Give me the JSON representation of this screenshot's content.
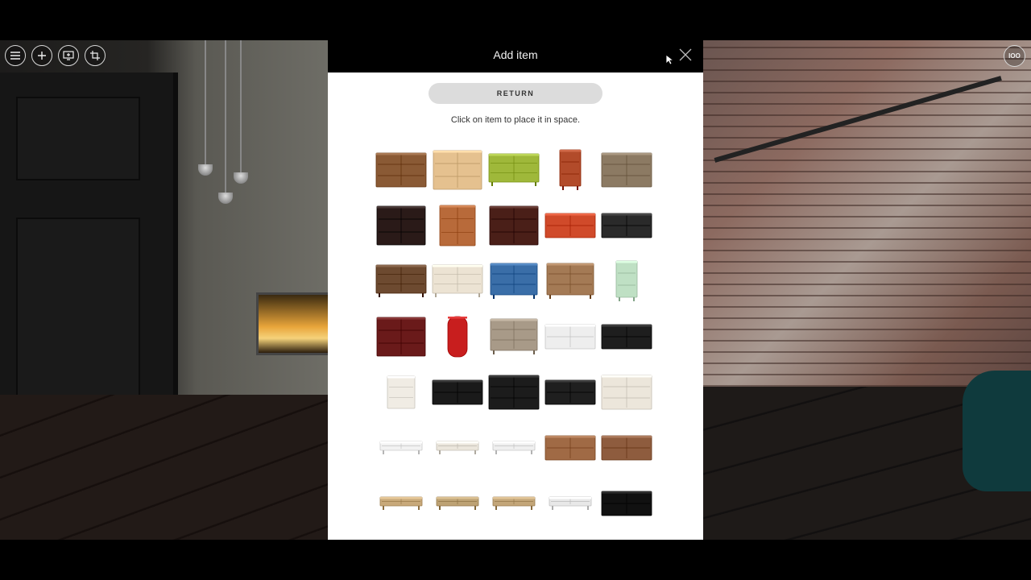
{
  "modal": {
    "title": "Add item",
    "return_label": "RETURN",
    "instruction": "Click on item to place it in space."
  },
  "toolbar": {
    "icons": [
      "menu-icon",
      "plus-icon",
      "screen-add-icon",
      "crop-icon"
    ],
    "right_icon_label": "IOO"
  },
  "catalog": [
    {
      "name": "dresser-wood-carved",
      "color": "#8a5a35",
      "shape": "wide"
    },
    {
      "name": "cabinet-light-wood",
      "color": "#e5c18f",
      "shape": "box"
    },
    {
      "name": "sideboard-lime-green",
      "color": "#9fb83a",
      "shape": "wide-legs"
    },
    {
      "name": "tall-chest-red-drawers",
      "color": "#b24b2a",
      "shape": "tall"
    },
    {
      "name": "sideboard-rustic",
      "color": "#8c7a63",
      "shape": "wide"
    },
    {
      "name": "cabinet-painted-black",
      "color": "#2a1a18",
      "shape": "box"
    },
    {
      "name": "chest-wood-drawers",
      "color": "#b86a3a",
      "shape": "tall-box"
    },
    {
      "name": "cabinet-dark-glass",
      "color": "#4a1f18",
      "shape": "box"
    },
    {
      "name": "dresser-orange-red",
      "color": "#d04a2a",
      "shape": "wide-low"
    },
    {
      "name": "console-black-metal",
      "color": "#2a2a2a",
      "shape": "wide-low"
    },
    {
      "name": "sideboard-walnut-legs",
      "color": "#6d4a30",
      "shape": "wide-legs"
    },
    {
      "name": "console-white-faceted",
      "color": "#ece3d3",
      "shape": "wide-legs"
    },
    {
      "name": "dresser-blue",
      "color": "#3a6ea8",
      "shape": "box-legs"
    },
    {
      "name": "dresser-natural-wood",
      "color": "#a47a55",
      "shape": "box-legs"
    },
    {
      "name": "chest-mint-tall",
      "color": "#bfe0c4",
      "shape": "tall"
    },
    {
      "name": "chest-mahogany",
      "color": "#6a1a1a",
      "shape": "box"
    },
    {
      "name": "round-cabinet-red",
      "color": "#c81e1e",
      "shape": "cylinder"
    },
    {
      "name": "chest-taupe",
      "color": "#a89a88",
      "shape": "box-legs"
    },
    {
      "name": "low-dresser-white",
      "color": "#eeeeee",
      "shape": "wide-low"
    },
    {
      "name": "low-chest-black",
      "color": "#1e1e1e",
      "shape": "wide-low"
    },
    {
      "name": "bedside-white",
      "color": "#f0ece4",
      "shape": "small"
    },
    {
      "name": "low-chest-black-2",
      "color": "#1a1a1a",
      "shape": "wide-low"
    },
    {
      "name": "dresser-black-wide",
      "color": "#1c1c1c",
      "shape": "wide"
    },
    {
      "name": "low-chest-black-3",
      "color": "#1f1f1f",
      "shape": "wide-low"
    },
    {
      "name": "dresser-cream",
      "color": "#ece6db",
      "shape": "wide"
    },
    {
      "name": "media-unit-white",
      "color": "#f2f2f2",
      "shape": "flat"
    },
    {
      "name": "media-unit-cream",
      "color": "#ebe6dc",
      "shape": "flat"
    },
    {
      "name": "media-unit-white-2",
      "color": "#efefef",
      "shape": "flat"
    },
    {
      "name": "sideboard-walnut-low",
      "color": "#a06a45",
      "shape": "wide-low"
    },
    {
      "name": "sideboard-brown-low",
      "color": "#8e5c3e",
      "shape": "wide-low"
    },
    {
      "name": "bench-wood-black",
      "color": "#c8a97a",
      "shape": "flat"
    },
    {
      "name": "bench-wood-black-2",
      "color": "#bda274",
      "shape": "flat"
    },
    {
      "name": "bench-wood-black-3",
      "color": "#c3a679",
      "shape": "flat"
    },
    {
      "name": "media-unit-white-3",
      "color": "#e8e8e8",
      "shape": "flat"
    },
    {
      "name": "console-black-wood",
      "color": "#111111",
      "shape": "wide-low"
    }
  ]
}
